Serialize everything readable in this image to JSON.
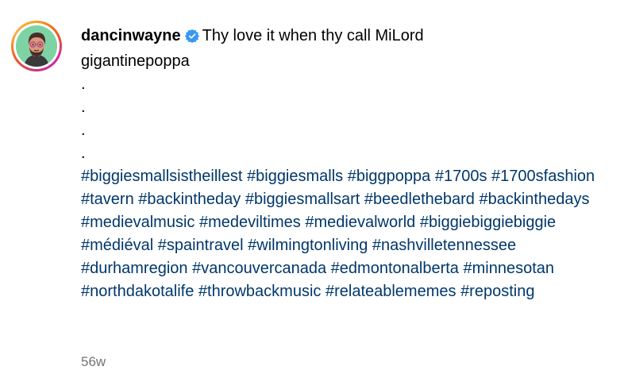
{
  "author": {
    "username": "dancinwayne",
    "verified": true,
    "verified_icon": "verified-badge-icon",
    "avatar_background": "#7ed3a5"
  },
  "caption": {
    "first_line": "Thy love it when thy call MiLord",
    "lines": [
      "gigantinepoppa",
      ".",
      ".",
      ".",
      "."
    ]
  },
  "hashtags": [
    "#biggiesmallsistheillest",
    "#biggiesmalls",
    "#biggpoppa",
    "#1700s",
    "#1700sfashion",
    "#tavern",
    "#backintheday",
    "#biggiesmallsart",
    "#beedlethebard",
    "#backinthedays",
    "#medievalmusic",
    "#medeviltimes",
    "#medievalworld",
    "#biggiebiggiebiggie",
    "#médiéval",
    "#spaintravel",
    "#wilmingtonliving",
    "#nashvilletennessee",
    "#durhamregion",
    "#vancouvercanada",
    "#edmontonalberta",
    "#minnesotan",
    "#northdakotalife",
    "#throwbackmusic",
    "#relateablememes",
    "#reposting"
  ],
  "timestamp": "56w",
  "colors": {
    "hashtag": "#00376b",
    "timestamp": "#737373",
    "verified": "#3897f0"
  }
}
